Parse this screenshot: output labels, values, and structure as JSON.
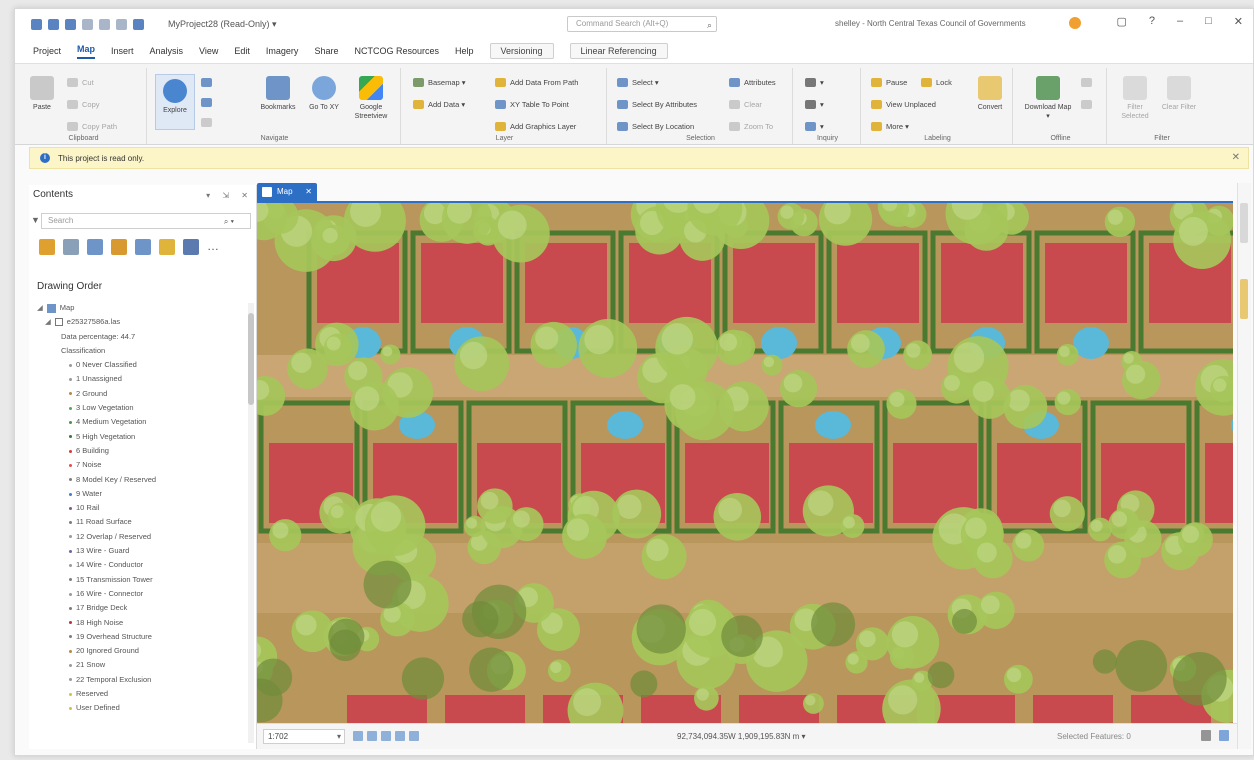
{
  "titlebar": {
    "project_title": "MyProject28 (Read-Only) ▾",
    "command_search": "Command Search (Alt+Q)",
    "signin": "shelley - North Central Texas Council of Governments"
  },
  "tabs": {
    "items": [
      "Project",
      "Map",
      "Insert",
      "Analysis",
      "View",
      "Edit",
      "Imagery",
      "Share",
      "NCTCOG Resources",
      "Help"
    ],
    "active": "Map",
    "contextual": [
      "Versioning",
      "Linear Referencing"
    ]
  },
  "ribbon": {
    "clipboard": {
      "title": "Clipboard",
      "paste": "Paste",
      "cut": "Cut",
      "copy": "Copy",
      "copy_path": "Copy Path"
    },
    "navigate": {
      "title": "Navigate",
      "explore": "Explore",
      "bookmarks": "Bookmarks",
      "goto_xy": "Go To XY",
      "google_streetview": "Google Streetview"
    },
    "layer": {
      "title": "Layer",
      "basemap": "Basemap ▾",
      "add_data": "Add Data ▾",
      "add_data_from_path": "Add Data From Path",
      "xy_table_to_point": "XY Table To Point",
      "add_graphics_layer": "Add Graphics Layer"
    },
    "selection": {
      "title": "Selection",
      "select": "Select ▾",
      "select_by_attributes": "Select By Attributes",
      "select_by_location": "Select By Location",
      "attributes": "Attributes",
      "clear": "Clear",
      "zoom_to": "Zoom To"
    },
    "inquiry": {
      "title": "Inquiry"
    },
    "labeling": {
      "title": "Labeling",
      "pause": "Pause",
      "lock": "Lock",
      "view_unplaced": "View Unplaced",
      "more": "More ▾",
      "convert": "Convert"
    },
    "offline": {
      "title": "Offline",
      "download_map": "Download Map ▾"
    },
    "filter": {
      "title": "Filter",
      "filter_selected": "Filter Selected",
      "clear_filter": "Clear Filter"
    }
  },
  "infobar": {
    "message": "This project is read only."
  },
  "contents": {
    "title": "Contents",
    "search_placeholder": "Search",
    "drawing_order": "Drawing Order",
    "map_label": "Map",
    "layer_name": "e25327586a.las",
    "data_percentage": "Data percentage: 44.7",
    "classification_label": "Classification",
    "classes": [
      {
        "label": "0 Never Classified",
        "color": "#9a9a9a"
      },
      {
        "label": "1 Unassigned",
        "color": "#9a9a9a"
      },
      {
        "label": "2 Ground",
        "color": "#b48a4a"
      },
      {
        "label": "3 Low Vegetation",
        "color": "#4caf50"
      },
      {
        "label": "4 Medium Vegetation",
        "color": "#3e9b43"
      },
      {
        "label": "5 High Vegetation",
        "color": "#2e7d32"
      },
      {
        "label": "6 Building",
        "color": "#d23c3c"
      },
      {
        "label": "7 Noise",
        "color": "#e05050"
      },
      {
        "label": "8 Model Key / Reserved",
        "color": "#7d7d7d"
      },
      {
        "label": "9 Water",
        "color": "#3e7fd1"
      },
      {
        "label": "10 Rail",
        "color": "#7a5a9a"
      },
      {
        "label": "11 Road Surface",
        "color": "#7d7d7d"
      },
      {
        "label": "12 Overlap / Reserved",
        "color": "#9a9a9a"
      },
      {
        "label": "13 Wire - Guard",
        "color": "#6a6a9a"
      },
      {
        "label": "14 Wire - Conductor",
        "color": "#9a9a9a"
      },
      {
        "label": "15 Transmission Tower",
        "color": "#7d7d7d"
      },
      {
        "label": "16 Wire - Connector",
        "color": "#9a9a9a"
      },
      {
        "label": "17 Bridge Deck",
        "color": "#7d7d7d"
      },
      {
        "label": "18 High Noise",
        "color": "#c03030"
      },
      {
        "label": "19 Overhead Structure",
        "color": "#7d7d7d"
      },
      {
        "label": "20 Ignored Ground",
        "color": "#b48a4a"
      },
      {
        "label": "21 Snow",
        "color": "#9a9a9a"
      },
      {
        "label": "22 Temporal Exclusion",
        "color": "#9a9a9a"
      },
      {
        "label": "Reserved",
        "color": "#d8c040"
      },
      {
        "label": "User Defined",
        "color": "#d8c040"
      }
    ]
  },
  "map": {
    "tab_label": "Map",
    "colors": {
      "ground": "#b8965c",
      "vegetation": "#a6c65a",
      "building": "#c94a4e",
      "water": "#5ab8d8",
      "hedge": "#4a7a30"
    }
  },
  "statusbar": {
    "scale": "1:702",
    "coordinates": "92,734,094.35W 1,909,195.83N m ▾",
    "selected_features": "Selected Features: 0"
  }
}
